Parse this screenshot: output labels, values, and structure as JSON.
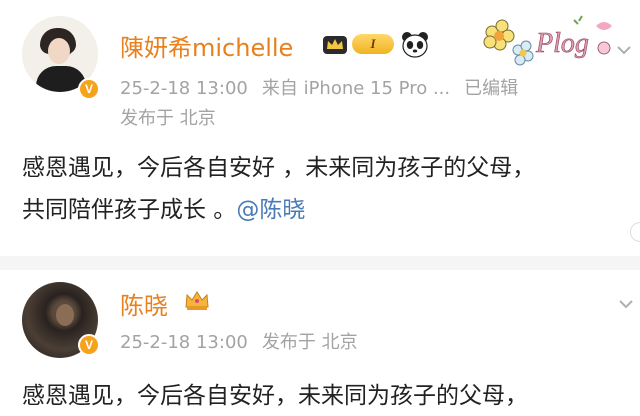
{
  "posts": [
    {
      "author": "陳妍希michelle",
      "level_badge": "I",
      "verified_badge": "V",
      "time": "25-2-18 13:00",
      "source": "来自 iPhone 15 Pro ...",
      "edited": "已编辑",
      "location": "发布于 北京",
      "text_line1": "感恩遇见，今后各自安好 ，未来同为孩子的父母，",
      "text_line2": "共同陪伴孩子成长 。",
      "mention": "@陈晓",
      "decoration_text": "Plog"
    },
    {
      "author": "陈晓",
      "verified_badge": "V",
      "time": "25-2-18 13:00",
      "location": "发布于 北京",
      "text_line1": "感恩遇见，今后各自安好，未来同为孩子的父母，"
    }
  ],
  "colors": {
    "author_name": "#e8811d",
    "meta_gray": "#a3a3a3",
    "mention_blue": "#4a7bb6",
    "verified_orange": "#f7a21b"
  },
  "icons": [
    "crown-icon",
    "level-badge",
    "panda-icon",
    "plog-flower-decoration",
    "chevron-down-icon"
  ]
}
